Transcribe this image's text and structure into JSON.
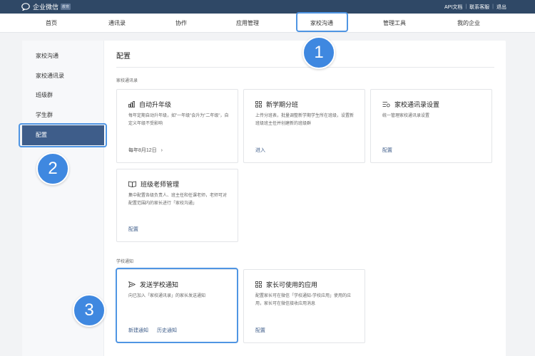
{
  "header": {
    "app_name": "企业微信",
    "app_tag": "教育",
    "links": [
      "API文档",
      "联系客服",
      "退出"
    ]
  },
  "nav": {
    "items": [
      "首页",
      "通讯录",
      "协作",
      "应用管理",
      "家校沟通",
      "管理工具",
      "我的企业"
    ],
    "active": "家校沟通"
  },
  "sidebar": {
    "items": [
      "家校沟通",
      "家校通讯录",
      "班级群",
      "学生群",
      "配置"
    ],
    "active": "配置"
  },
  "main": {
    "title": "配置",
    "section1": "家校通讯录",
    "section2": "学校通知"
  },
  "cards": {
    "auto_upgrade": {
      "title": "自动升年级",
      "desc": "每年定期自动升年级，如\"一年级\"会升为\"二年级\"，自定义年级不受影响",
      "link": "每年8月12日",
      "icon": "bar-chart-icon"
    },
    "new_term": {
      "title": "新学期分班",
      "desc": "上传分班表，批量调整新学期学生所在班级，设置新班级班主任并创建新的班级群",
      "link": "进入",
      "icon": "grid-icon"
    },
    "contacts_settings": {
      "title": "家校通讯录设置",
      "desc": "统一管理家校通讯录设置",
      "link": "配置",
      "icon": "list-settings-icon"
    },
    "teacher_mgmt": {
      "title": "班级老师管理",
      "desc": "集中配置各级负责人、班主任和任课老师，老师可对配置范围内的家长进行「家校沟通」",
      "link": "配置",
      "icon": "book-icon"
    },
    "send_notice": {
      "title": "发送学校通知",
      "desc": "向已加入「家校通讯录」的家长发送通知",
      "links": [
        "新建通知",
        "历史通知"
      ],
      "icon": "send-icon"
    },
    "parent_apps": {
      "title": "家长可使用的应用",
      "desc": "配置家长可在微信「学校通知-学校应用」使用的应用，家长可在微信接收应用消息",
      "link": "配置",
      "icon": "apps-icon"
    }
  },
  "callouts": [
    "1",
    "2",
    "3"
  ],
  "colors": {
    "header_bg": "#2f4866",
    "accent": "#3e5d8a",
    "callout": "#3f88e0",
    "highlight_border": "#4f95e3"
  }
}
